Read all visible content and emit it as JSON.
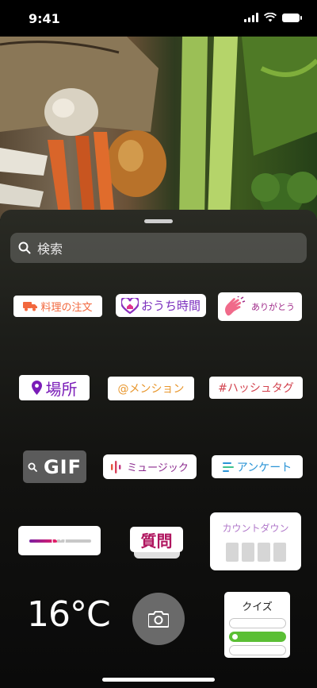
{
  "status_bar": {
    "time": "9:41"
  },
  "search": {
    "placeholder": "検索"
  },
  "stickers": {
    "food_order": "料理の注文",
    "stay_home": "おうち時間",
    "thanks": "ありがとう",
    "location": "場所",
    "mention": "@メンション",
    "hashtag": "#ハッシュタグ",
    "gif": "GIF",
    "music": "ミュージック",
    "poll": "アンケート",
    "questions": "質問",
    "countdown": "カウントダウン",
    "temperature": "16°C",
    "quiz": "クイズ",
    "emoji_slider_emoji": "😍"
  },
  "colors": {
    "food_order": "#f2683e",
    "stay_home": "#7b2fbe",
    "location": "#7a1cb8",
    "mention": "#e8962c",
    "hashtag": "#d2424e",
    "music": "#8b2a8e",
    "poll": "#2a94d6",
    "questions": "#b0155f",
    "quiz_correct": "#5bbf35"
  },
  "emoji_slider": {
    "level": 0.45
  }
}
